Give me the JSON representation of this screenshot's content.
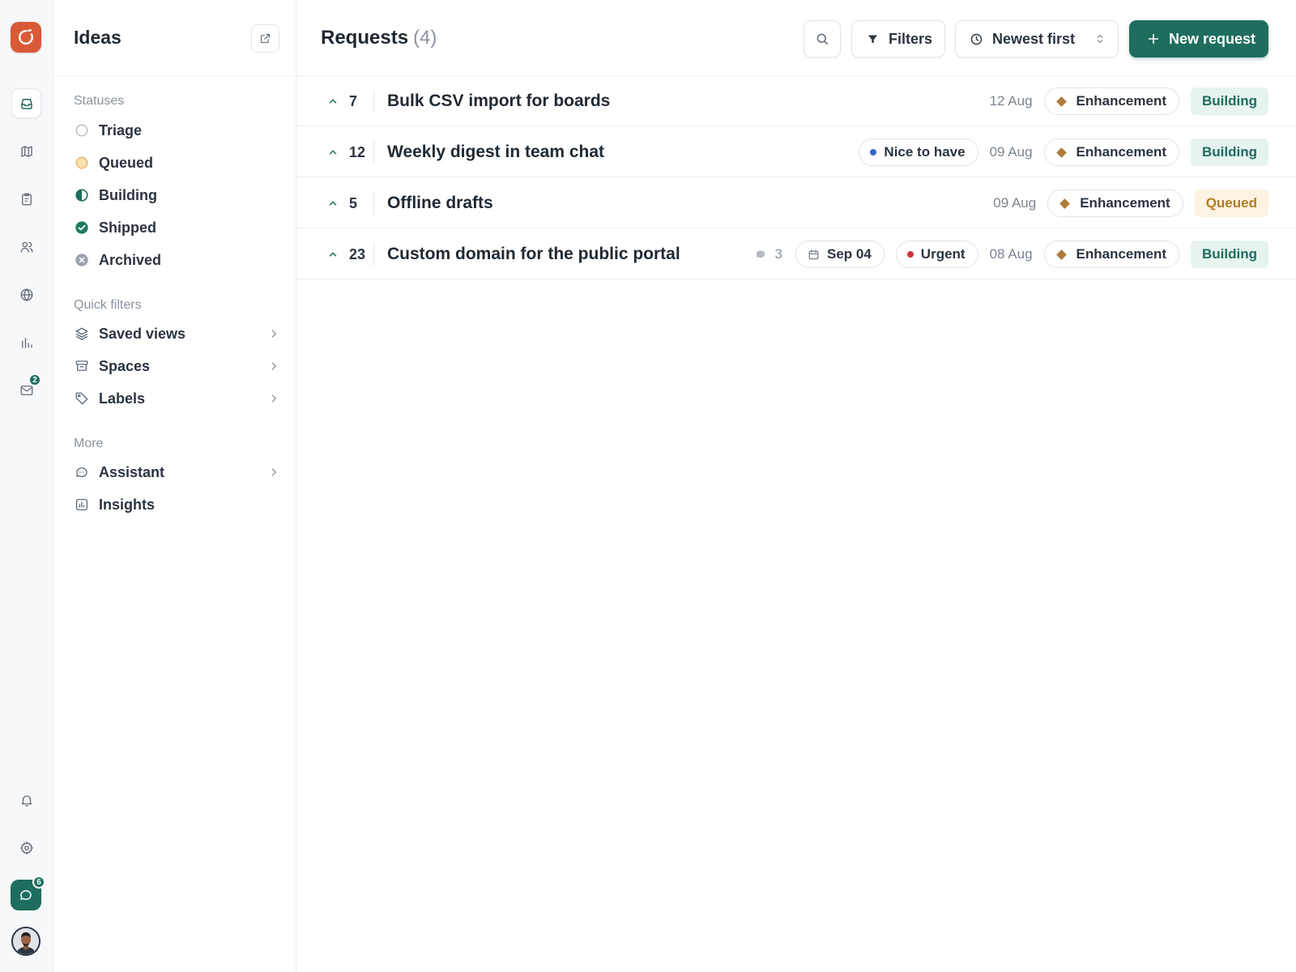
{
  "rail": {
    "items": [
      {
        "icon": "inbox-icon",
        "active": true
      },
      {
        "icon": "map-icon",
        "active": false
      },
      {
        "icon": "clipboard-icon",
        "active": false
      },
      {
        "icon": "users-icon",
        "active": false
      },
      {
        "icon": "globe-icon",
        "active": false
      },
      {
        "icon": "bar-chart-icon",
        "active": false
      },
      {
        "icon": "mail-icon",
        "active": false,
        "badge": "2"
      }
    ],
    "bottom": [
      {
        "icon": "bell-icon"
      },
      {
        "icon": "gear-icon"
      }
    ],
    "chat_badge": "6"
  },
  "sidebar": {
    "title": "Ideas",
    "statuses_title": "Statuses",
    "statuses": [
      {
        "label": "Triage",
        "icon": "circle-empty-icon"
      },
      {
        "label": "Queued",
        "icon": "circle-queued-icon"
      },
      {
        "label": "Building",
        "icon": "circle-half-icon"
      },
      {
        "label": "Shipped",
        "icon": "check-circle-icon"
      },
      {
        "label": "Archived",
        "icon": "x-circle-icon"
      }
    ],
    "quick_title": "Quick filters",
    "quick": [
      {
        "label": "Saved views",
        "icon": "layers-icon"
      },
      {
        "label": "Spaces",
        "icon": "archive-box-icon"
      },
      {
        "label": "Labels",
        "icon": "tag-icon"
      }
    ],
    "more_title": "More",
    "more": [
      {
        "label": "Assistant",
        "icon": "chat-bubble-icon",
        "chevron": true
      },
      {
        "label": "Insights",
        "icon": "chart-box-icon",
        "chevron": false
      }
    ]
  },
  "main": {
    "title": "Requests",
    "count": "(4)",
    "filters_label": "Filters",
    "sort_label": "Newest first",
    "new_label": "New request"
  },
  "colors": {
    "accent": "#1d6e5e",
    "logo": "#d95a37",
    "building_bg": "#e6f3ef",
    "building_fg": "#1d6e5e",
    "queued_bg": "#fdf3e3",
    "queued_fg": "#b57d1f"
  },
  "requests": [
    {
      "votes": "7",
      "title": "Bulk CSV import for boards",
      "comments": null,
      "due": null,
      "priority": null,
      "date": "12 Aug",
      "category": "Enhancement",
      "status": "Building"
    },
    {
      "votes": "12",
      "title": "Weekly digest in team chat",
      "comments": null,
      "due": null,
      "priority": {
        "label": "Nice to have",
        "color": "#3b64c8"
      },
      "date": "09 Aug",
      "category": "Enhancement",
      "status": "Building"
    },
    {
      "votes": "5",
      "title": "Offline drafts",
      "comments": null,
      "due": null,
      "priority": null,
      "date": "09 Aug",
      "category": "Enhancement",
      "status": "Queued"
    },
    {
      "votes": "23",
      "title": "Custom domain for the public portal",
      "comments": "3",
      "due": "Sep 04",
      "priority": {
        "label": "Urgent",
        "color": "#c8373d"
      },
      "date": "08 Aug",
      "category": "Enhancement",
      "status": "Building"
    }
  ]
}
